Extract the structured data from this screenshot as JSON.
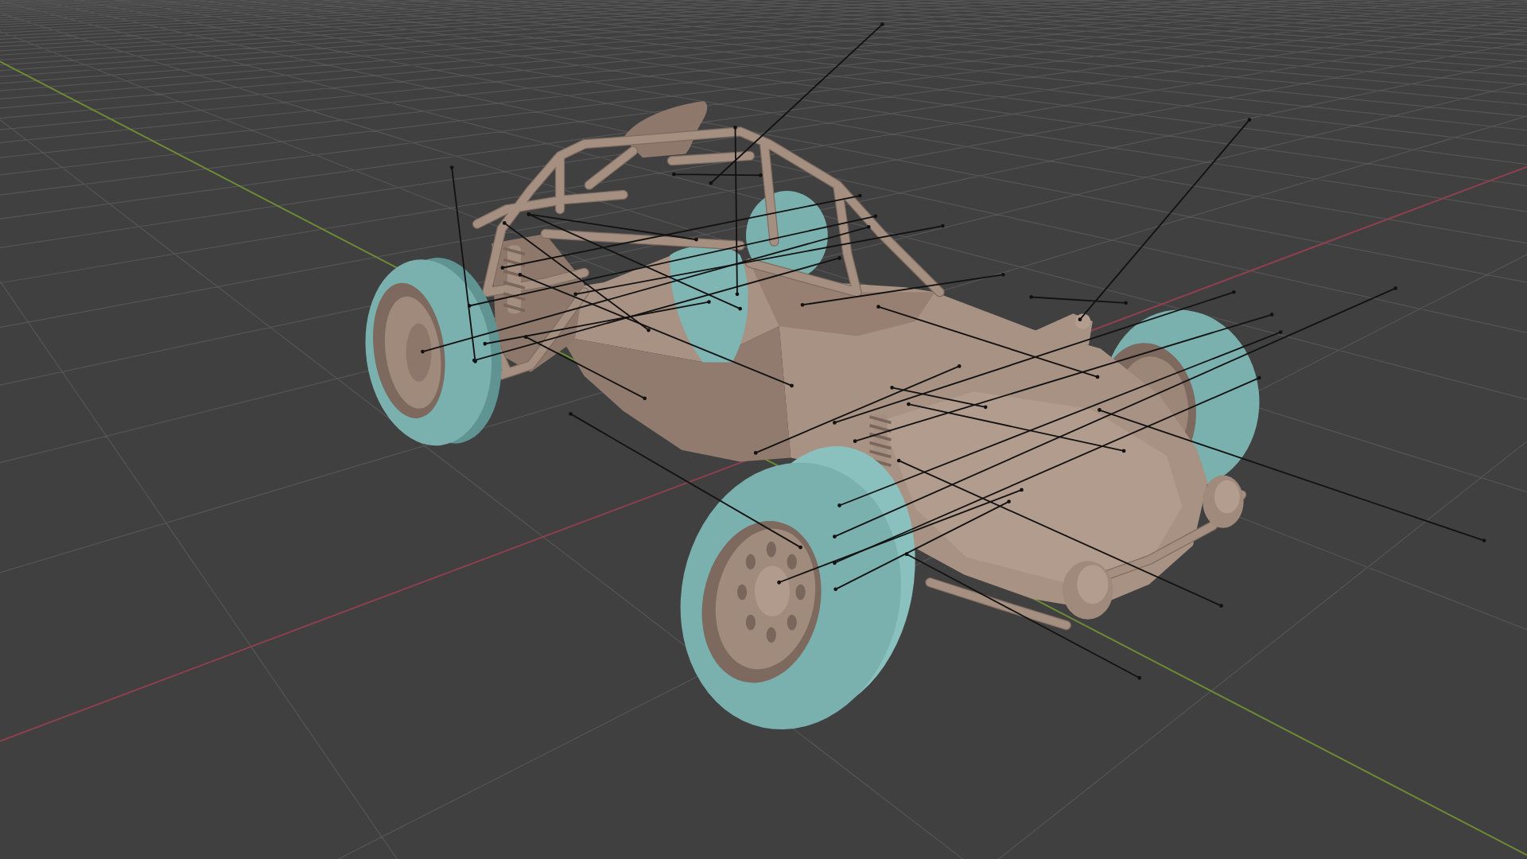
{
  "viewport": {
    "axes": [
      {
        "color": "#8f3f4f"
      },
      {
        "color": "#6d8b34"
      }
    ]
  }
}
